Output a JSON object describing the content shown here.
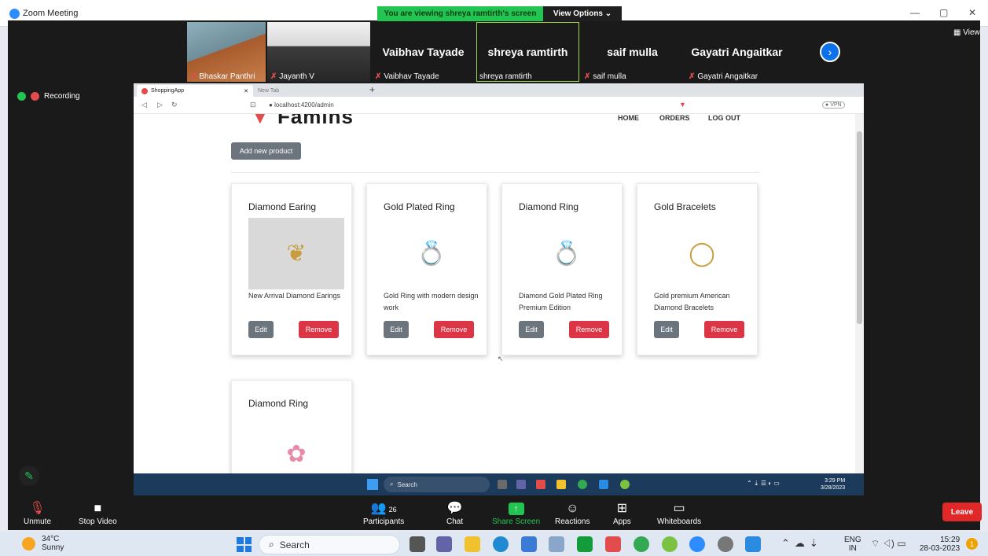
{
  "zoom": {
    "window_title": "Zoom Meeting",
    "banner_text": "You are viewing shreya ramtirth's screen",
    "view_options": "View Options",
    "view": "View",
    "recording": "Recording",
    "participants": [
      {
        "label": "Bhaskar Panthri",
        "big": "",
        "kind": "photo1"
      },
      {
        "label": "Jayanth V",
        "big": "",
        "kind": "photo2"
      },
      {
        "label": "Vaibhav Tayade",
        "big": "Vaibhav Tayade",
        "kind": "name"
      },
      {
        "label": "shreya ramtirth",
        "big": "shreya ramtirth",
        "kind": "name"
      },
      {
        "label": "saif mulla",
        "big": "saif mulla",
        "kind": "name"
      },
      {
        "label": "Gayatri Angaitkar",
        "big": "Gayatri Angaitkar",
        "kind": "name"
      }
    ],
    "toolbar": {
      "unmute": "Unmute",
      "stop_video": "Stop Video",
      "participants": "Participants",
      "participants_count": "26",
      "chat": "Chat",
      "share_screen": "Share Screen",
      "reactions": "Reactions",
      "apps": "Apps",
      "whiteboards": "Whiteboards",
      "leave": "Leave"
    }
  },
  "browser": {
    "tab_active": "ShoppingApp",
    "tab_inactive": "New Tab",
    "url": "localhost:4200/admin",
    "vpn": "VPN"
  },
  "app": {
    "brand": "Famins",
    "nav": [
      "HOME",
      "ORDERS",
      "LOG OUT"
    ],
    "add_button": "Add new product",
    "edit_label": "Edit",
    "remove_label": "Remove",
    "products": [
      {
        "title": "Diamond Earing",
        "description": "New Arrival Diamond Earings",
        "image": "earring-image"
      },
      {
        "title": "Gold Plated Ring",
        "description": "Gold Ring with modern design work",
        "image": "gold-ring-image"
      },
      {
        "title": "Diamond Ring",
        "description": "Diamond Gold Plated Ring Premium Edition",
        "image": "diamond-ring-image"
      },
      {
        "title": "Gold Bracelets",
        "description": "Gold premium American Diamond Bracelets",
        "image": "bracelet-image"
      },
      {
        "title": "Diamond Ring",
        "description": "",
        "image": "flower-ring-image"
      }
    ]
  },
  "shared_taskbar": {
    "search": "Search",
    "time": "3:29 PM",
    "date": "3/28/2023"
  },
  "taskbar": {
    "temp": "34°C",
    "weather": "Sunny",
    "search": "Search",
    "lang1": "ENG",
    "lang2": "IN",
    "time": "15:29",
    "date": "28-03-2023",
    "notifications": "1"
  }
}
